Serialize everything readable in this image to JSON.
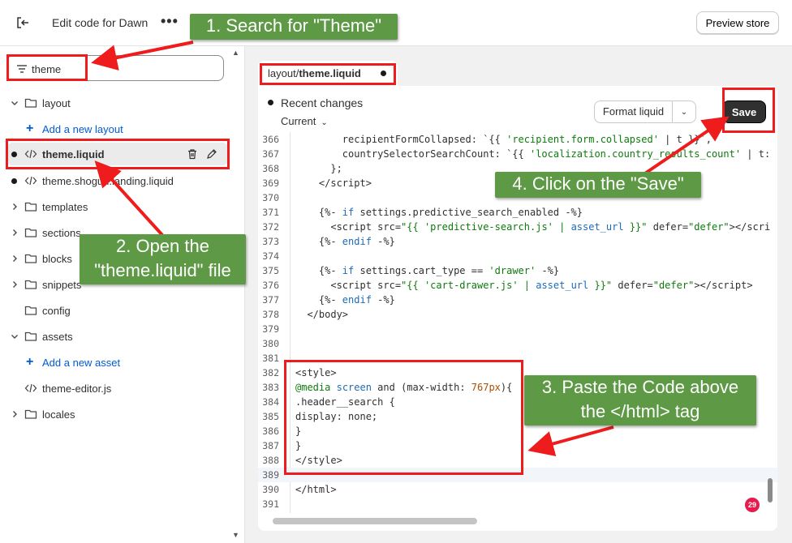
{
  "header": {
    "title": "Edit code for Dawn",
    "more_label": "•••",
    "preview_label": "Preview store"
  },
  "sidebar": {
    "search_value": "theme",
    "items": [
      {
        "label": "layout",
        "type": "folder",
        "expanded": true
      },
      {
        "label": "Add a new layout",
        "type": "add"
      },
      {
        "label": "theme.liquid",
        "type": "file",
        "modified": true,
        "selected": true
      },
      {
        "label": "theme.shogun.landing.liquid",
        "type": "file",
        "modified": true
      },
      {
        "label": "templates",
        "type": "folder"
      },
      {
        "label": "sections",
        "type": "folder"
      },
      {
        "label": "blocks",
        "type": "folder"
      },
      {
        "label": "snippets",
        "type": "folder"
      },
      {
        "label": "config",
        "type": "folder"
      },
      {
        "label": "assets",
        "type": "folder",
        "expanded": true
      },
      {
        "label": "Add a new asset",
        "type": "add"
      },
      {
        "label": "theme-editor.js",
        "type": "file"
      },
      {
        "label": "locales",
        "type": "folder"
      }
    ]
  },
  "editor": {
    "tab_prefix": "layout/",
    "tab_file": "theme.liquid",
    "recent_changes": "Recent changes",
    "current_label": "Current",
    "format_label": "Format liquid",
    "save_label": "Save",
    "notification_count": "29",
    "line_numbers": [
      "366",
      "367",
      "368",
      "369",
      "370",
      "371",
      "372",
      "373",
      "374",
      "375",
      "376",
      "377",
      "378",
      "379",
      "380",
      "381",
      "382",
      "383",
      "384",
      "385",
      "386",
      "387",
      "388",
      "389",
      "390",
      "391"
    ]
  },
  "annotations": {
    "step1": "1. Search for \"Theme\"",
    "step2_line1": "2. Open the",
    "step2_line2": "\"theme.liquid\" file",
    "step3_line1": "3. Paste the Code above",
    "step3_line2": "the </html> tag",
    "step4": "4. Click on the \"Save\""
  },
  "colors": {
    "annotation_green": "#5e9a46",
    "annotation_red": "#ee1c1c",
    "save_button": "#303030",
    "link_blue": "#005bd3"
  }
}
